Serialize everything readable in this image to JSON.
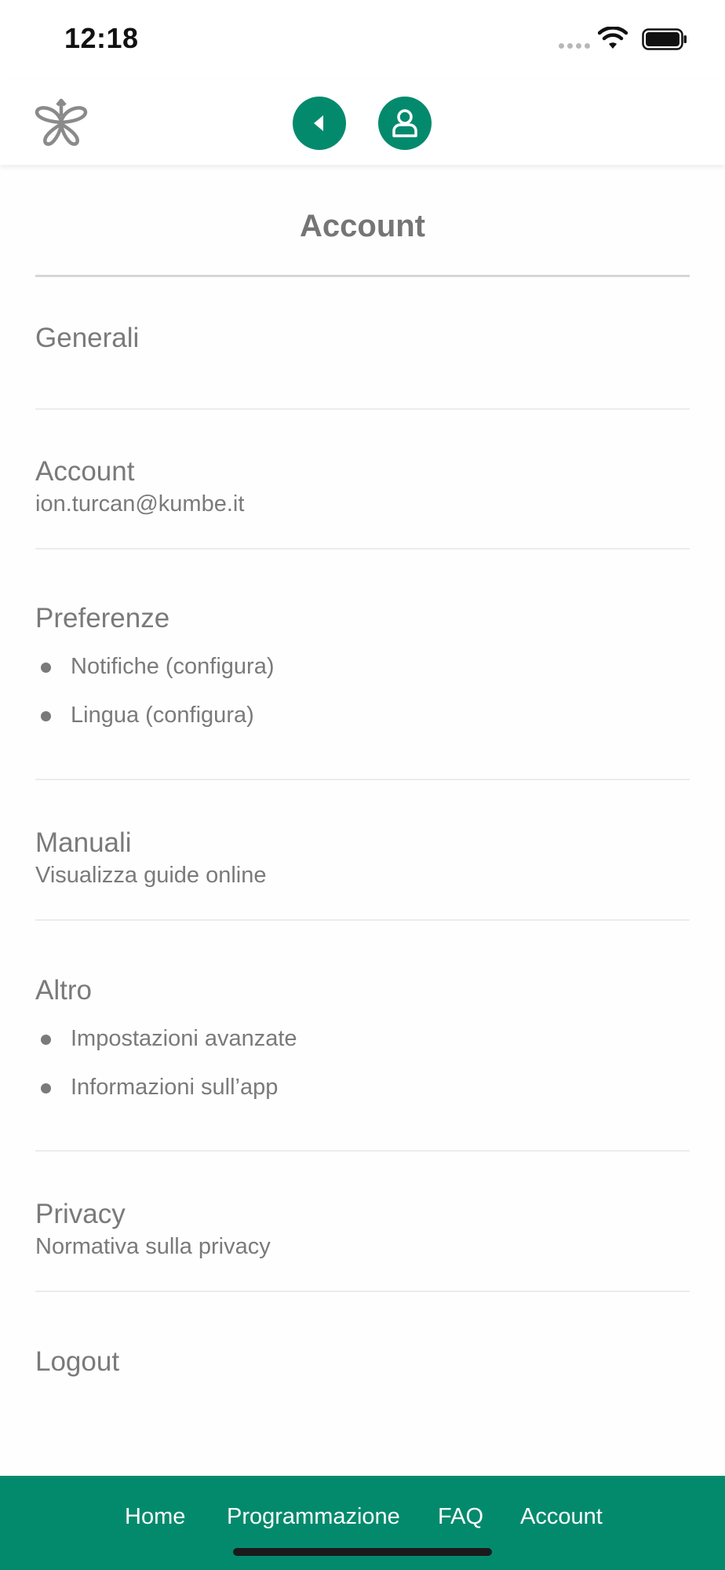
{
  "status_bar": {
    "time": "12:18"
  },
  "header": {
    "logo_icon": "butterfly-logo-icon",
    "back_icon": "back-arrow-icon",
    "profile_icon": "user-icon",
    "accent_color": "#038a6d"
  },
  "page": {
    "title": "Account"
  },
  "sections": {
    "generali": {
      "heading": "Generali"
    },
    "account": {
      "heading": "Account",
      "sub": "ion.turcan@kumbe.it"
    },
    "preferenze": {
      "heading": "Preferenze",
      "items": [
        "Notifiche (configura)",
        "Lingua (configura)"
      ]
    },
    "manuali": {
      "heading": "Manuali",
      "sub": "Visualizza guide online"
    },
    "altro": {
      "heading": "Altro",
      "items": [
        "Impostazioni avanzate",
        "Informazioni sull’app"
      ]
    },
    "privacy": {
      "heading": "Privacy",
      "sub": "Normativa sulla privacy"
    },
    "logout": {
      "heading": "Logout"
    }
  },
  "bottom_nav": {
    "items": [
      "Home",
      "Programmazione",
      "FAQ",
      "Account"
    ]
  }
}
